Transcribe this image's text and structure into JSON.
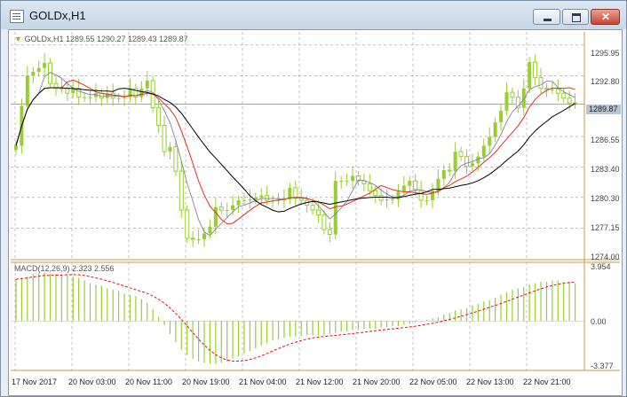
{
  "window": {
    "title": "GOLDx,H1"
  },
  "chart": {
    "legend_main": "GOLDx,H1  1289.55 1290.27 1289.43 1289.87",
    "legend_macd": "MACD(12,26,9) 2.323 2.556",
    "current_price": "1289.87",
    "price_ticks": [
      "1295.95",
      "1292.80",
      "1289.87",
      "1286.55",
      "1283.40",
      "1280.30",
      "1277.15",
      "1274.00"
    ],
    "macd_ticks": [
      "3.954",
      "0.00",
      "-3.377"
    ],
    "time_labels": [
      "17 Nov 2017",
      "20 Nov 03:00",
      "20 Nov 11:00",
      "20 Nov 19:00",
      "21 Nov 04:00",
      "21 Nov 12:00",
      "21 Nov 20:00",
      "22 Nov 05:00",
      "22 Nov 13:00",
      "22 Nov 21:00"
    ],
    "colors": {
      "bull": "#9acd32",
      "bear": "#9acd32",
      "ma_fast": "#8080a0",
      "ma_mid": "#e03020",
      "ma_slow": "#000000",
      "macd_signal": "#e01010",
      "grid": "#9a9a9a",
      "axis": "#c89a3c"
    }
  },
  "chart_data": {
    "type": "candlestick",
    "symbol": "GOLDx",
    "timeframe": "H1",
    "ylim": [
      1274.0,
      1297.3
    ],
    "close_values": [
      1285.6,
      1289.7,
      1292.8,
      1293.2,
      1293.6,
      1294.1,
      1292.0,
      1291.5,
      1291.5,
      1291.0,
      1291.5,
      1290.6,
      1290.6,
      1290.6,
      1291.0,
      1290.5,
      1291.0,
      1290.5,
      1290.5,
      1290.6,
      1291.5,
      1290.6,
      1291.5,
      1292.3,
      1289.5,
      1287.7,
      1285.0,
      1285.5,
      1283.0,
      1279.0,
      1276.1,
      1276.0,
      1276.0,
      1276.6,
      1277.3,
      1279.3,
      1279.0,
      1279.0,
      1279.5,
      1280.0,
      1280.0,
      1280.1,
      1280.3,
      1280.5,
      1280.0,
      1280.0,
      1280.0,
      1280.1,
      1281.3,
      1280.2,
      1280.0,
      1279.5,
      1279.0,
      1278.5,
      1277.0,
      1276.5,
      1282.0,
      1282.0,
      1282.0,
      1282.5,
      1282.0,
      1281.7,
      1281.0,
      1280.5,
      1280.0,
      1280.1,
      1280.1,
      1280.9,
      1281.5,
      1282.0,
      1281.0,
      1280.0,
      1280.0,
      1281.0,
      1282.2,
      1283.1,
      1283.0,
      1285.0,
      1284.5,
      1283.5,
      1283.8,
      1284.5,
      1285.6,
      1286.5,
      1288.0,
      1289.2,
      1291.1,
      1290.6,
      1289.5,
      1291.5,
      1294.2,
      1292.6,
      1291.5,
      1291.4,
      1291.4,
      1291.0,
      1290.5,
      1290.0,
      1289.9
    ],
    "macd_range": [
      -3.377,
      3.954
    ],
    "macd_values": [
      3.2,
      3.3,
      3.4,
      3.6,
      3.7,
      3.7,
      3.6,
      3.6,
      3.5,
      3.5,
      3.4,
      3.3,
      3.1,
      2.9,
      2.8,
      2.7,
      2.5,
      2.4,
      2.3,
      2.1,
      2.0,
      1.9,
      1.7,
      1.4,
      0.9,
      0.3,
      -0.3,
      -1.0,
      -1.6,
      -2.2,
      -2.6,
      -2.9,
      -3.1,
      -3.2,
      -3.3,
      -3.3,
      -3.2,
      -3.1,
      -2.9,
      -2.7,
      -2.5,
      -2.3,
      -2.1,
      -1.9,
      -1.7,
      -1.5,
      -1.4,
      -1.3,
      -1.2,
      -1.2,
      -1.2,
      -1.1,
      -1.1,
      -1.1,
      -1.1,
      -1.0,
      -0.9,
      -0.8,
      -0.8,
      -0.7,
      -0.7,
      -0.6,
      -0.6,
      -0.6,
      -0.5,
      -0.5,
      -0.4,
      -0.4,
      -0.3,
      -0.2,
      -0.1,
      0.0,
      0.1,
      0.2,
      0.3,
      0.5,
      0.6,
      0.8,
      0.9,
      1.0,
      1.2,
      1.3,
      1.5,
      1.6,
      1.8,
      2.0,
      2.2,
      2.4,
      2.5,
      2.6,
      2.8,
      2.9,
      3.0,
      3.0,
      3.1,
      3.1,
      3.0,
      3.0,
      2.9
    ]
  }
}
